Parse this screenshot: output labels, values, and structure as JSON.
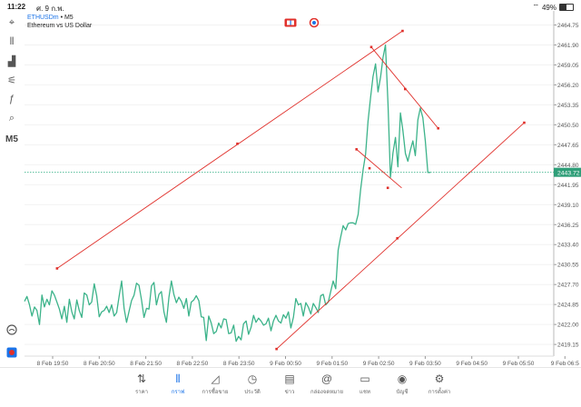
{
  "status_bar": {
    "time": "11:22",
    "date": "ศ. 9 ก.พ.",
    "battery": "49%",
    "battery_level": 0.49
  },
  "symbol": {
    "name": "ETHUSDm",
    "sep": " • ",
    "timeframe": "M5",
    "description": "Ethereum vs US Dollar"
  },
  "left_toolbar": [
    {
      "name": "crosshair-icon",
      "glyph": "⌖"
    },
    {
      "name": "candles-icon",
      "glyph": "⫴"
    },
    {
      "name": "bars-icon",
      "glyph": "▟"
    },
    {
      "name": "indicators-icon",
      "glyph": "⚟"
    },
    {
      "name": "function-icon",
      "glyph": "ƒ"
    },
    {
      "name": "objects-icon",
      "glyph": "⌕"
    },
    {
      "name": "timeframe-label",
      "text": "M5"
    }
  ],
  "colors": {
    "price_line": "#3cb38a",
    "trend_lines": "#e0302b",
    "current_price_bg": "#2e9e78",
    "grid": "#f2f2f2",
    "accent": "#1a73e8"
  },
  "chart_data": {
    "type": "line",
    "price_axis": [
      "2464.75",
      "2461.90",
      "2459.05",
      "2456.20",
      "2453.35",
      "2450.50",
      "2447.65",
      "2444.80",
      "2441.95",
      "2439.10",
      "2436.25",
      "2433.40",
      "2430.55",
      "2427.70",
      "2424.85",
      "2422.00",
      "2419.15"
    ],
    "time_axis": [
      "8 Feb 19:50",
      "8 Feb 20:50",
      "8 Feb 21:50",
      "8 Feb 22:50",
      "8 Feb 23:50",
      "9 Feb 00:50",
      "9 Feb 01:50",
      "9 Feb 02:50",
      "9 Feb 03:50",
      "9 Feb 04:50",
      "9 Feb 05:50",
      "9 Feb 06:5"
    ],
    "current_price": "2443.72",
    "current_price_value": 2443.72,
    "ylim": [
      2418.0,
      2466.5
    ],
    "xlim": [
      0,
      1
    ],
    "series": [
      {
        "values": [
          2425.3,
          2426.0,
          2424.8,
          2423.2,
          2424.5,
          2424.0,
          2422.0,
          2426.2,
          2424.5,
          2425.6,
          2424.8,
          2426.8,
          2426.2,
          2425.2,
          2424.2,
          2422.8,
          2424.6,
          2422.3,
          2425.6,
          2423.8,
          2422.8,
          2425.5,
          2424.0,
          2423.0,
          2426.5,
          2426.2,
          2424.8,
          2425.2,
          2427.8,
          2426.1,
          2423.1,
          2423.8,
          2424.0,
          2424.6,
          2423.7,
          2424.8,
          2423.2,
          2423.7,
          2426.0,
          2428.2,
          2424.3,
          2422.3,
          2423.9,
          2425.4,
          2426.2,
          2427.9,
          2427.6,
          2425.5,
          2423.0,
          2424.3,
          2424.2,
          2427.5,
          2428.0,
          2424.8,
          2426.3,
          2426.7,
          2423.8,
          2422.3,
          2425.9,
          2428.2,
          2426.3,
          2425.1,
          2425.9,
          2425.3,
          2424.3,
          2425.7,
          2423.2,
          2425.2,
          2425.5,
          2426.1,
          2425.4,
          2423.1,
          2423.0,
          2419.7,
          2423.2,
          2422.2,
          2420.7,
          2421.0,
          2422.2,
          2421.5,
          2422.8,
          2422.7,
          2420.7,
          2420.8,
          2421.9,
          2419.6,
          2420.3,
          2419.8,
          2422.1,
          2422.5,
          2420.6,
          2421.6,
          2423.3,
          2422.3,
          2422.9,
          2422.5,
          2421.9,
          2422.1,
          2422.9,
          2421.1,
          2422.5,
          2423.3,
          2422.5,
          2422.2,
          2423.4,
          2422.9,
          2423.8,
          2421.5,
          2423.0,
          2425.7,
          2424.8,
          2425.0,
          2423.2,
          2425.1,
          2424.5,
          2423.5,
          2425.0,
          2424.4,
          2423.7,
          2426.1,
          2426.3,
          2424.8,
          2425.2,
          2426.7,
          2428.2,
          2427.1,
          2432.6,
          2434.5,
          2436.1,
          2435.5,
          2436.4,
          2436.5,
          2436.5,
          2436.3,
          2437.7,
          2441.2,
          2444.1,
          2446.3,
          2451.0,
          2454.4,
          2457.4,
          2459.2,
          2455.2,
          2457.3,
          2460.1,
          2461.9,
          2453.5,
          2443.0,
          2446.5,
          2448.7,
          2444.5,
          2452.2,
          2449.7,
          2446.4,
          2445.3,
          2446.9,
          2448.2,
          2446.1,
          2451.2,
          2452.9,
          2451.5,
          2448.2,
          2443.7,
          2443.7
        ]
      }
    ],
    "trend_lines": [
      {
        "x": [
          0.0615,
          0.7143
        ],
        "y": [
          2430.0,
          2463.9
        ]
      },
      {
        "x": [
          0.4762,
          0.9442
        ],
        "y": [
          2418.5,
          2450.8
        ]
      },
      {
        "x": [
          0.6552,
          0.7816
        ],
        "y": [
          2461.6,
          2450.0
        ]
      },
      {
        "x": [
          0.6273,
          0.7126
        ],
        "y": [
          2447.0,
          2441.5
        ]
      }
    ],
    "trend_points": [
      {
        "x": 0.0615,
        "y": 2430.0
      },
      {
        "x": 0.4022,
        "y": 2447.8
      },
      {
        "x": 0.7143,
        "y": 2463.9
      },
      {
        "x": 0.4762,
        "y": 2418.5
      },
      {
        "x": 0.7044,
        "y": 2434.3
      },
      {
        "x": 0.9442,
        "y": 2450.8
      },
      {
        "x": 0.6552,
        "y": 2461.6
      },
      {
        "x": 0.7192,
        "y": 2455.6
      },
      {
        "x": 0.7816,
        "y": 2450.0
      },
      {
        "x": 0.6273,
        "y": 2447.0
      },
      {
        "x": 0.6519,
        "y": 2444.3
      },
      {
        "x": 0.6864,
        "y": 2441.5
      }
    ]
  },
  "tabs": [
    {
      "name": "tab-quotes",
      "icon": "⇅",
      "label": "ราคา"
    },
    {
      "name": "tab-chart",
      "icon": "⫴",
      "label": "กราฟ",
      "active": true
    },
    {
      "name": "tab-trade",
      "icon": "◿",
      "label": "การซื้อขาย"
    },
    {
      "name": "tab-history",
      "icon": "◷",
      "label": "ประวัติ"
    },
    {
      "name": "tab-news",
      "icon": "▤",
      "label": "ข่าว"
    },
    {
      "name": "tab-mailbox",
      "icon": "@",
      "label": "กล่องจดหมาย"
    },
    {
      "name": "tab-chat",
      "icon": "▭",
      "label": "แชท"
    },
    {
      "name": "tab-accounts",
      "icon": "◉",
      "label": "บัญชี"
    },
    {
      "name": "tab-settings",
      "icon": "⚙",
      "label": "การตั้งค่า"
    }
  ]
}
